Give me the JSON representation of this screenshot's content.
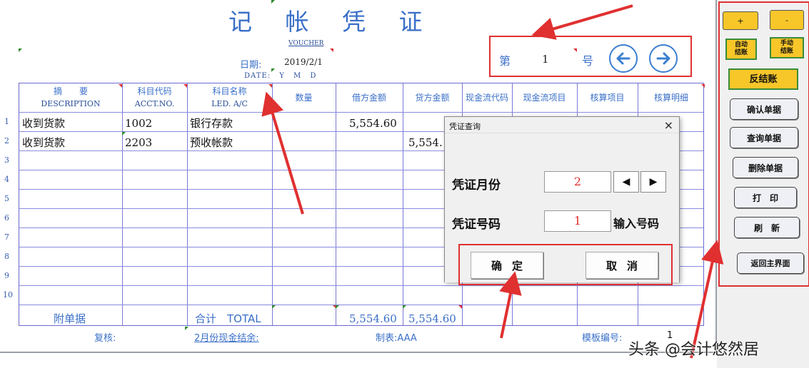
{
  "sheet": {
    "title": "记 帐 凭 证",
    "voucher_label": "VOUCHER",
    "date_label": "日期:",
    "date_value": "2019/2/1",
    "date_sub": "DATE: Y M D",
    "number_label": "第",
    "number_value": "1",
    "number_suffix": "号",
    "columns": [
      {
        "cn": "摘　　要",
        "en": "DESCRIPTION"
      },
      {
        "cn": "科目代码",
        "en": "ACCT.NO."
      },
      {
        "cn": "科目名称",
        "en": "LED. A/C"
      },
      {
        "cn": "数量",
        "en": ""
      },
      {
        "cn": "借方金额",
        "en": ""
      },
      {
        "cn": "贷方金额",
        "en": ""
      },
      {
        "cn": "现金流代码",
        "en": ""
      },
      {
        "cn": "现金流项目",
        "en": ""
      },
      {
        "cn": "核算项目",
        "en": ""
      },
      {
        "cn": "核算明细",
        "en": ""
      }
    ],
    "row_numbers": [
      "1",
      "2",
      "3",
      "4",
      "5",
      "6",
      "7",
      "8",
      "9",
      "10"
    ],
    "rows": [
      {
        "description": "收到货款",
        "acct_no": "1002",
        "account": "银行存款",
        "debit": "5,554.60",
        "credit": ""
      },
      {
        "description": "收到货款",
        "acct_no": "2203",
        "account": "预收帐款",
        "debit": "",
        "credit": "5,554."
      }
    ],
    "totals": {
      "attachments_label": "附单据",
      "total_label": "合计　TOTAL",
      "debit_total": "5,554.60",
      "credit_total": "5,554.60"
    },
    "footer": {
      "review_label": "复核:",
      "cash_balance_link": "2月份现金结余:",
      "preparer": "制表:AAA",
      "template_label": "模板编号:",
      "template_value": "1"
    }
  },
  "dialog": {
    "title": "凭证查询",
    "close": "×",
    "month_label": "凭证月份",
    "month_value": "2",
    "prev": "◀",
    "next": "▶",
    "number_label": "凭证号码",
    "number_value": "1",
    "number_hint": "输入号码",
    "ok": "确定",
    "cancel": "取消"
  },
  "panel": {
    "plus": "+",
    "minus": "-",
    "auto_close": "自动\n结账",
    "manual_close": "手动\n结账",
    "reverse_close": "反结账",
    "confirm": "确认单据",
    "query": "查询单据",
    "delete": "删除单据",
    "print": "打　印",
    "refresh": "刷　新",
    "home": "返回主界面"
  },
  "watermark": "头条 @会计悠然居",
  "colors": {
    "title_blue": "#3a6fc8",
    "grid_line": "#7a7ad8",
    "highlight_red": "#e03030",
    "button_yellow": "#f7c629",
    "amount_red": "#e03030"
  }
}
